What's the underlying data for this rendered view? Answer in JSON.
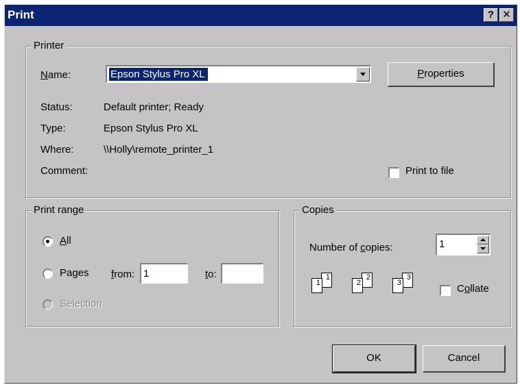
{
  "titlebar": {
    "title": "Print",
    "help_label": "?",
    "close_label": "✕"
  },
  "printer": {
    "legend": "Printer",
    "name_label": "Name:",
    "name_value": "Epson Stylus Pro XL",
    "properties_label": "Properties",
    "status_label": "Status:",
    "status_value": "Default printer; Ready",
    "type_label": "Type:",
    "type_value": "Epson Stylus Pro XL",
    "where_label": "Where:",
    "where_value": "\\\\Holly\\remote_printer_1",
    "comment_label": "Comment:",
    "comment_value": "",
    "print_to_file_label": "Print to file",
    "print_to_file_checked": false
  },
  "print_range": {
    "legend": "Print range",
    "all_label": "All",
    "pages_label": "Pages",
    "from_label": "from:",
    "from_value": "1",
    "to_label": "to:",
    "to_value": "",
    "selection_label": "Selection",
    "selected": "all"
  },
  "copies": {
    "legend": "Copies",
    "number_label": "Number of copies:",
    "number_value": "1",
    "collate_label": "Collate",
    "collate_checked": false,
    "collate_pages": [
      "1",
      "1",
      "2",
      "2",
      "3",
      "3"
    ]
  },
  "buttons": {
    "ok_label": "OK",
    "cancel_label": "Cancel"
  },
  "colors": {
    "titlebar": "#0a2472",
    "face": "#c6c3c6",
    "selection": "#0a2472"
  }
}
